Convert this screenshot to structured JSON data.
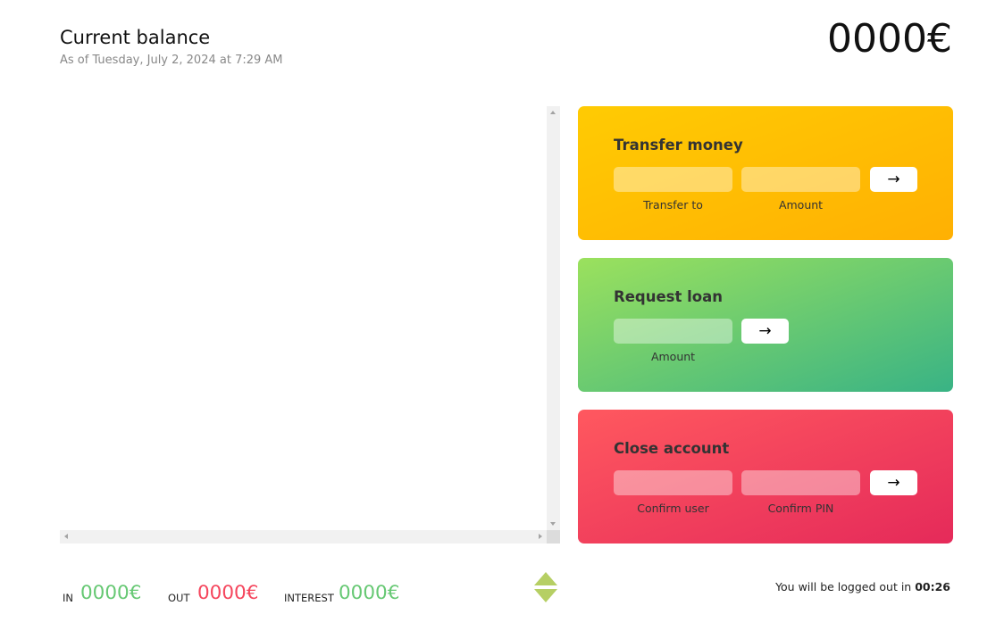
{
  "balance": {
    "title": "Current balance",
    "date_text": "As of Tuesday, July 2, 2024 at 7:29 AM",
    "value": "0000€"
  },
  "operations": {
    "transfer": {
      "title": "Transfer money",
      "to_label": "Transfer to",
      "amount_label": "Amount",
      "submit_label": "→",
      "to_value": "",
      "amount_value": ""
    },
    "loan": {
      "title": "Request loan",
      "amount_label": "Amount",
      "submit_label": "→",
      "amount_value": ""
    },
    "close": {
      "title": "Close account",
      "user_label": "Confirm user",
      "pin_label": "Confirm PIN",
      "submit_label": "→",
      "user_value": "",
      "pin_value": ""
    }
  },
  "summary": {
    "in_label": "In",
    "in_value": "0000€",
    "out_label": "Out",
    "out_value": "0000€",
    "interest_label": "Interest",
    "interest_value": "0000€",
    "sort_icon": "sort-icon"
  },
  "logout": {
    "text": "You will be logged out in ",
    "timer": "00:26"
  },
  "colors": {
    "transfer_gradient": [
      "#ffcb03",
      "#ffb003"
    ],
    "loan_gradient": [
      "#9be15d",
      "#39b385"
    ],
    "close_gradient": [
      "#ff585f",
      "#e52a5a"
    ],
    "deposit_green": "#66c873",
    "withdrawal_red": "#f5465d",
    "sort_icon_color": "#b6cf64"
  }
}
